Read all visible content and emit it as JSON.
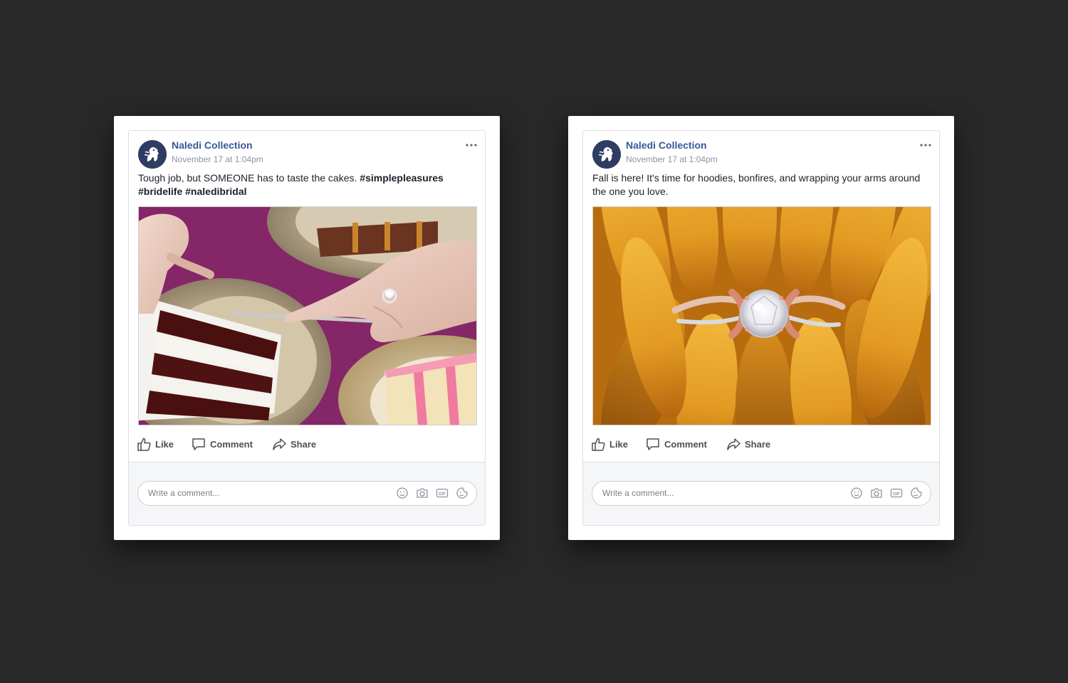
{
  "colors": {
    "background": "#282828",
    "author_link": "#385898",
    "avatar": "#2f3d63"
  },
  "posts": [
    {
      "author": "Naledi Collection",
      "timestamp": "November 17 at 1:04pm",
      "caption_text": "Tough job, but SOMEONE has to taste the cakes. ",
      "hashtags": [
        "#simplepleasures",
        "#bridelife",
        "#naledibridal"
      ],
      "photo_icon": "cake-photo",
      "actions": {
        "like": "Like",
        "comment": "Comment",
        "share": "Share"
      },
      "comment_placeholder": "Write a comment..."
    },
    {
      "author": "Naledi Collection",
      "timestamp": "November 17 at 1:04pm",
      "caption_text": "Fall is here! It's time for hoodies, bonfires, and wrapping your arms around the one you love.",
      "hashtags": [],
      "photo_icon": "ring-on-flower-photo",
      "actions": {
        "like": "Like",
        "comment": "Comment",
        "share": "Share"
      },
      "comment_placeholder": "Write a comment..."
    }
  ]
}
